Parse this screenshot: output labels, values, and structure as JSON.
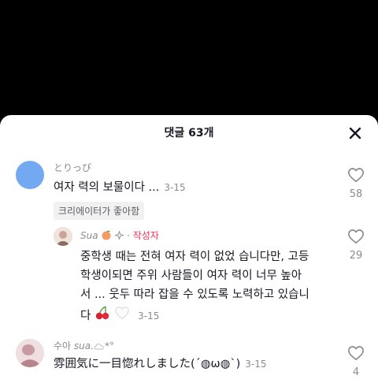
{
  "sheet": {
    "title": "댓글 63개"
  },
  "comments": [
    {
      "username": "とりっぴ",
      "text": "여자 력의 보물이다 ...",
      "date": "3-15",
      "likes": "58",
      "creator_badge": "크리에이터가 좋아함"
    },
    {
      "username": "Sua",
      "author_separator": "·",
      "author_tag": "작성자",
      "text_lines": [
        "중학생 때는 전혀 여자 력이 없었 습니다만, 고등",
        "학생이되면 주위 사람들이 여자 력이 너무 높아",
        "서 ... 웃두 따라 잡을 수 있도록 노력하고 있습니",
        "다"
      ],
      "date": "3-15",
      "likes": "29"
    },
    {
      "username_prefix": "수아",
      "username": "sua.",
      "username_suffix": "*°",
      "text": "雰囲気に一目惚れしました(ˊ◍ω◍ˋ)",
      "date": "3-15",
      "likes": "4"
    }
  ],
  "icons": {
    "close": "close-icon",
    "like": "heart-outline-icon",
    "peach": "peach-emoji",
    "sparkle": "sparkle-emoji",
    "cherries": "cherries-emoji",
    "white_heart": "white-heart-emoji",
    "cloud": "cloud-emoji"
  },
  "colors": {
    "background": "#000000",
    "sheet": "#ffffff",
    "avatar_blue": "#73a9f0",
    "author_tag": "#fe2c55",
    "secondary_text": "#8a8b91"
  }
}
